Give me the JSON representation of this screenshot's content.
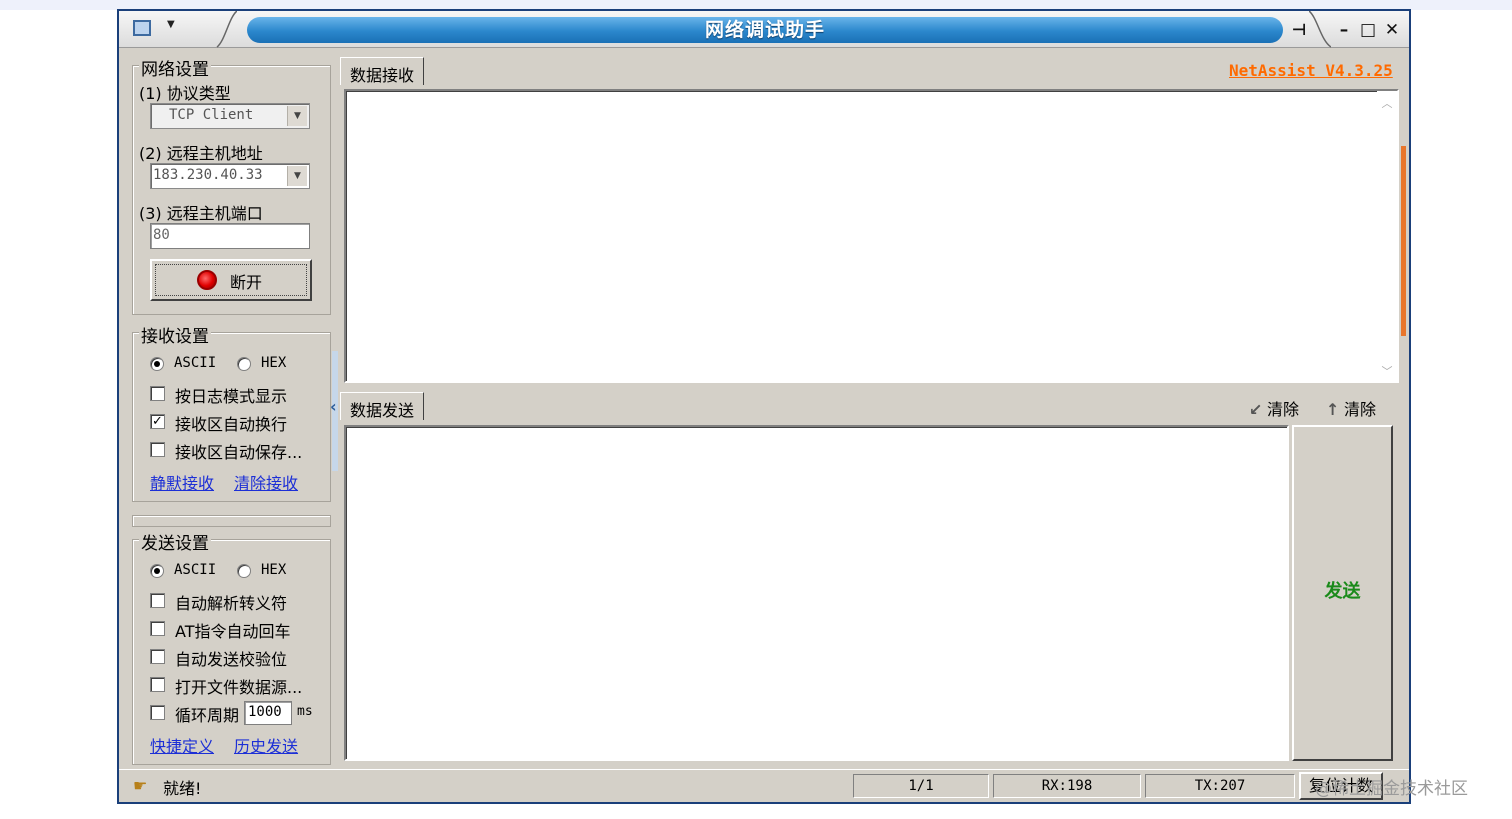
{
  "window": {
    "title": "网络调试助手",
    "version": "NetAssist V4.3.25"
  },
  "network": {
    "group_label": "网络设置",
    "protocol_label": "(1) 协议类型",
    "protocol_value": "TCP Client",
    "host_label": "(2) 远程主机地址",
    "host_value": "183.230.40.33",
    "port_label": "(3) 远程主机端口",
    "port_value": "80",
    "connect_button": "断开"
  },
  "receive_settings": {
    "group_label": "接收设置",
    "ascii": "ASCII",
    "hex": "HEX",
    "mode_selected": "ASCII",
    "log_mode": {
      "label": "按日志模式显示",
      "checked": false
    },
    "auto_wrap": {
      "label": "接收区自动换行",
      "checked": true
    },
    "auto_save": {
      "label": "接收区自动保存...",
      "checked": false
    },
    "silent_link": "静默接收",
    "clear_link": "清除接收"
  },
  "send_settings": {
    "group_label": "发送设置",
    "ascii": "ASCII",
    "hex": "HEX",
    "mode_selected": "ASCII",
    "auto_escape": {
      "label": "自动解析转义符",
      "checked": false
    },
    "at_cr": {
      "label": "AT指令自动回车",
      "checked": false
    },
    "auto_checksum": {
      "label": "自动发送校验位",
      "checked": false
    },
    "file_source": {
      "label": "打开文件数据源...",
      "checked": false
    },
    "loop": {
      "label": "循环周期",
      "checked": false,
      "value": "1000",
      "unit": "ms"
    },
    "shortcut_link": "快捷定义",
    "history_link": "历史发送"
  },
  "receive_tab": "数据接收",
  "send_tab": "数据发送",
  "clear_buttons": [
    "清除",
    "清除"
  ],
  "send_button": "发送",
  "status": {
    "text": "就绪!",
    "page": "1/1",
    "rx": "RX:198",
    "tx": "TX:207",
    "reset": "复位计数"
  },
  "watermark": "@稀土掘金技术社区"
}
